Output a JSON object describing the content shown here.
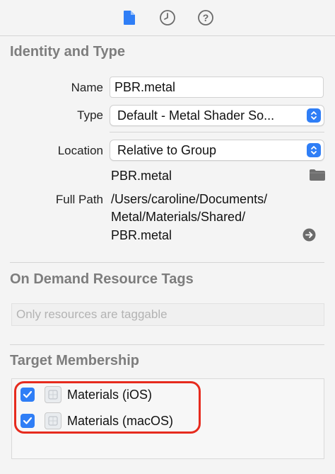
{
  "toolbar": {
    "icons": [
      "file-inspector-icon",
      "history-inspector-icon",
      "help-inspector-icon"
    ],
    "accent": "#2f7ef6"
  },
  "identity": {
    "title": "Identity and Type",
    "name_label": "Name",
    "name_value": "PBR.metal",
    "type_label": "Type",
    "type_value": "Default - Metal Shader So...",
    "location_label": "Location",
    "location_value": "Relative to Group",
    "file_name": "PBR.metal",
    "full_path_label": "Full Path",
    "full_path_lines": [
      "/Users/caroline/Documents/",
      "Metal/Materials/Shared/",
      "PBR.metal"
    ]
  },
  "on_demand": {
    "title": "On Demand Resource Tags",
    "placeholder": "Only resources are taggable"
  },
  "target_membership": {
    "title": "Target Membership",
    "targets": [
      {
        "label": "Materials (iOS)",
        "checked": true
      },
      {
        "label": "Materials (macOS)",
        "checked": true
      }
    ],
    "highlight_color": "#e62b1e"
  }
}
